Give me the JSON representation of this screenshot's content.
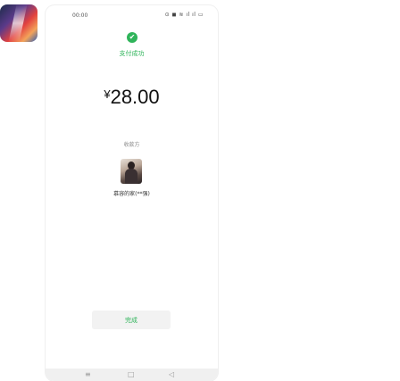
{
  "status_bar": {
    "time": "00:00",
    "icons": "⊙ ◼ ≋ ıl ıl ▭"
  },
  "result": {
    "status_label": "支付成功",
    "currency_symbol": "¥",
    "amount": "28.00"
  },
  "payee": {
    "caption": "收款方",
    "name": "慕容的家(**强)"
  },
  "actions": {
    "done_label": "完成"
  },
  "nav": {
    "menu": "≡",
    "home": "□",
    "back": "◁"
  },
  "colors": {
    "accent": "#2fb45a"
  }
}
